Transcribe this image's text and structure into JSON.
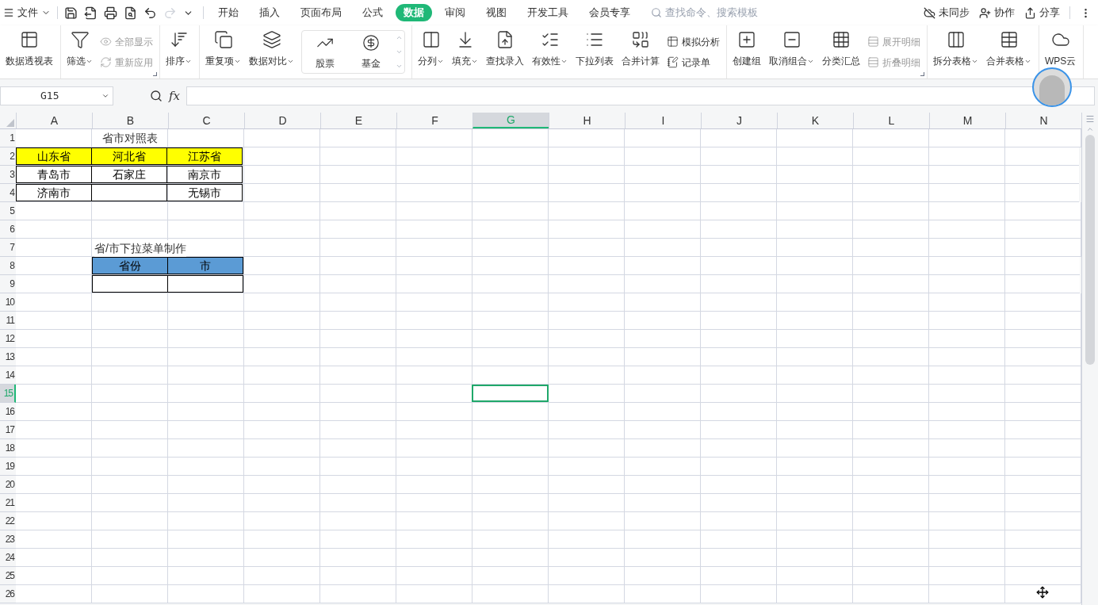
{
  "menu": {
    "file": "文件"
  },
  "tabs": [
    {
      "label": "开始",
      "selected": false
    },
    {
      "label": "插入",
      "selected": false
    },
    {
      "label": "页面布局",
      "selected": false
    },
    {
      "label": "公式",
      "selected": false
    },
    {
      "label": "数据",
      "selected": true
    },
    {
      "label": "审阅",
      "selected": false
    },
    {
      "label": "视图",
      "selected": false
    },
    {
      "label": "开发工具",
      "selected": false
    },
    {
      "label": "会员专享",
      "selected": false
    }
  ],
  "search": {
    "placeholder": "查找命令、搜索模板"
  },
  "actions": [
    "未同步",
    "协作",
    "分享"
  ],
  "ribbon": [
    {
      "items": [
        {
          "kind": "large",
          "label": "数据透视表",
          "dropdown": false,
          "disabled": false
        }
      ]
    },
    {
      "launcher": true,
      "items": [
        {
          "kind": "large",
          "label": "筛选",
          "dropdown": true,
          "disabled": false
        },
        {
          "kind": "stack",
          "children": [
            {
              "label": "全部显示",
              "disabled": true
            },
            {
              "label": "重新应用",
              "disabled": true
            }
          ]
        }
      ]
    },
    {
      "items": [
        {
          "kind": "large",
          "label": "排序",
          "dropdown": true,
          "disabled": false
        }
      ]
    },
    {
      "items": [
        {
          "kind": "large",
          "label": "重复项",
          "dropdown": true,
          "disabled": false
        },
        {
          "kind": "large",
          "label": "数据对比",
          "dropdown": true,
          "disabled": false
        },
        {
          "kind": "gallery",
          "children": [
            {
              "label": "股票"
            },
            {
              "label": "基金"
            }
          ]
        }
      ]
    },
    {
      "items": [
        {
          "kind": "large",
          "label": "分列",
          "dropdown": true,
          "disabled": false
        },
        {
          "kind": "large",
          "label": "填充",
          "dropdown": true,
          "disabled": false
        },
        {
          "kind": "large",
          "label": "查找录入",
          "dropdown": false,
          "disabled": false
        },
        {
          "kind": "large",
          "label": "有效性",
          "dropdown": true,
          "disabled": false
        },
        {
          "kind": "large",
          "label": "下拉列表",
          "dropdown": false,
          "disabled": false
        },
        {
          "kind": "large",
          "label": "合并计算",
          "dropdown": false,
          "disabled": false
        },
        {
          "kind": "stack",
          "children": [
            {
              "label": "模拟分析",
              "disabled": false
            },
            {
              "label": "记录单",
              "disabled": false
            }
          ]
        }
      ]
    },
    {
      "launcher": true,
      "items": [
        {
          "kind": "large",
          "label": "创建组",
          "dropdown": false,
          "disabled": false
        },
        {
          "kind": "large",
          "label": "取消组合",
          "dropdown": true,
          "disabled": false
        },
        {
          "kind": "large",
          "label": "分类汇总",
          "dropdown": false,
          "disabled": false
        },
        {
          "kind": "stack",
          "children": [
            {
              "label": "展开明细",
              "disabled": true
            },
            {
              "label": "折叠明细",
              "disabled": true
            }
          ]
        }
      ]
    },
    {
      "items": [
        {
          "kind": "large",
          "label": "拆分表格",
          "dropdown": true,
          "disabled": false
        },
        {
          "kind": "large",
          "label": "合并表格",
          "dropdown": true,
          "disabled": false
        }
      ]
    },
    {
      "items": [
        {
          "kind": "large",
          "label": "WPS云",
          "dropdown": false,
          "disabled": false
        }
      ]
    }
  ],
  "formula_bar": {
    "name_box": "G15",
    "fx_label": "fx"
  },
  "sheet": {
    "columns": [
      {
        "label": "A",
        "selected": false
      },
      {
        "label": "B",
        "selected": false
      },
      {
        "label": "C",
        "selected": false
      },
      {
        "label": "D",
        "selected": false
      },
      {
        "label": "E",
        "selected": false
      },
      {
        "label": "F",
        "selected": false
      },
      {
        "label": "G",
        "selected": true
      },
      {
        "label": "H",
        "selected": false
      },
      {
        "label": "I",
        "selected": false
      },
      {
        "label": "J",
        "selected": false
      },
      {
        "label": "K",
        "selected": false
      },
      {
        "label": "L",
        "selected": false
      },
      {
        "label": "M",
        "selected": false
      },
      {
        "label": "N",
        "selected": false
      }
    ],
    "rows": [
      {
        "label": "1",
        "selected": false,
        "cells": [
          {
            "kind": "plain"
          },
          {
            "kind": "plain",
            "text": "省市对照表"
          }
        ]
      },
      {
        "label": "2",
        "selected": false,
        "cells": [
          {
            "kind": "boxed",
            "text": "山东省",
            "color": "#ffff00"
          },
          {
            "kind": "boxed",
            "text": "河北省",
            "color": "#ffff00"
          },
          {
            "kind": "boxed",
            "text": "江苏省",
            "color": "#ffff00"
          }
        ]
      },
      {
        "label": "3",
        "selected": false,
        "cells": [
          {
            "kind": "boxed",
            "text": "青岛市"
          },
          {
            "kind": "boxed",
            "text": "石家庄"
          },
          {
            "kind": "boxed",
            "text": "南京市"
          }
        ]
      },
      {
        "label": "4",
        "selected": false,
        "cells": [
          {
            "kind": "boxed",
            "text": "济南市"
          },
          {
            "kind": "boxed"
          },
          {
            "kind": "boxed",
            "text": "无锡市"
          }
        ]
      },
      {
        "label": "5",
        "selected": false,
        "cells": []
      },
      {
        "label": "6",
        "selected": false,
        "cells": []
      },
      {
        "label": "7",
        "selected": false,
        "cells": [
          {
            "kind": "plain"
          },
          {
            "kind": "overflow",
            "text": "省/市下拉菜单制作"
          }
        ]
      },
      {
        "label": "8",
        "selected": false,
        "cells": [
          {
            "kind": "plain"
          },
          {
            "kind": "boxed",
            "text": "省份",
            "color": "#5b9bd5"
          },
          {
            "kind": "boxed",
            "text": "市",
            "color": "#5b9bd5"
          }
        ]
      },
      {
        "label": "9",
        "selected": false,
        "cells": [
          {
            "kind": "plain"
          },
          {
            "kind": "boxed"
          },
          {
            "kind": "boxed"
          }
        ]
      },
      {
        "label": "10",
        "selected": false,
        "cells": []
      },
      {
        "label": "11",
        "selected": false,
        "cells": []
      },
      {
        "label": "12",
        "selected": false,
        "cells": []
      },
      {
        "label": "13",
        "selected": false,
        "cells": []
      },
      {
        "label": "14",
        "selected": false,
        "cells": []
      },
      {
        "label": "15",
        "selected": true,
        "cells": []
      },
      {
        "label": "16",
        "selected": false,
        "cells": []
      },
      {
        "label": "17",
        "selected": false,
        "cells": []
      },
      {
        "label": "18",
        "selected": false,
        "cells": []
      },
      {
        "label": "19",
        "selected": false,
        "cells": []
      },
      {
        "label": "20",
        "selected": false,
        "cells": []
      },
      {
        "label": "21",
        "selected": false,
        "cells": []
      },
      {
        "label": "22",
        "selected": false,
        "cells": []
      },
      {
        "label": "23",
        "selected": false,
        "cells": []
      },
      {
        "label": "24",
        "selected": false,
        "cells": []
      },
      {
        "label": "25",
        "selected": false,
        "cells": []
      },
      {
        "label": "26",
        "selected": false,
        "cells": []
      }
    ]
  }
}
